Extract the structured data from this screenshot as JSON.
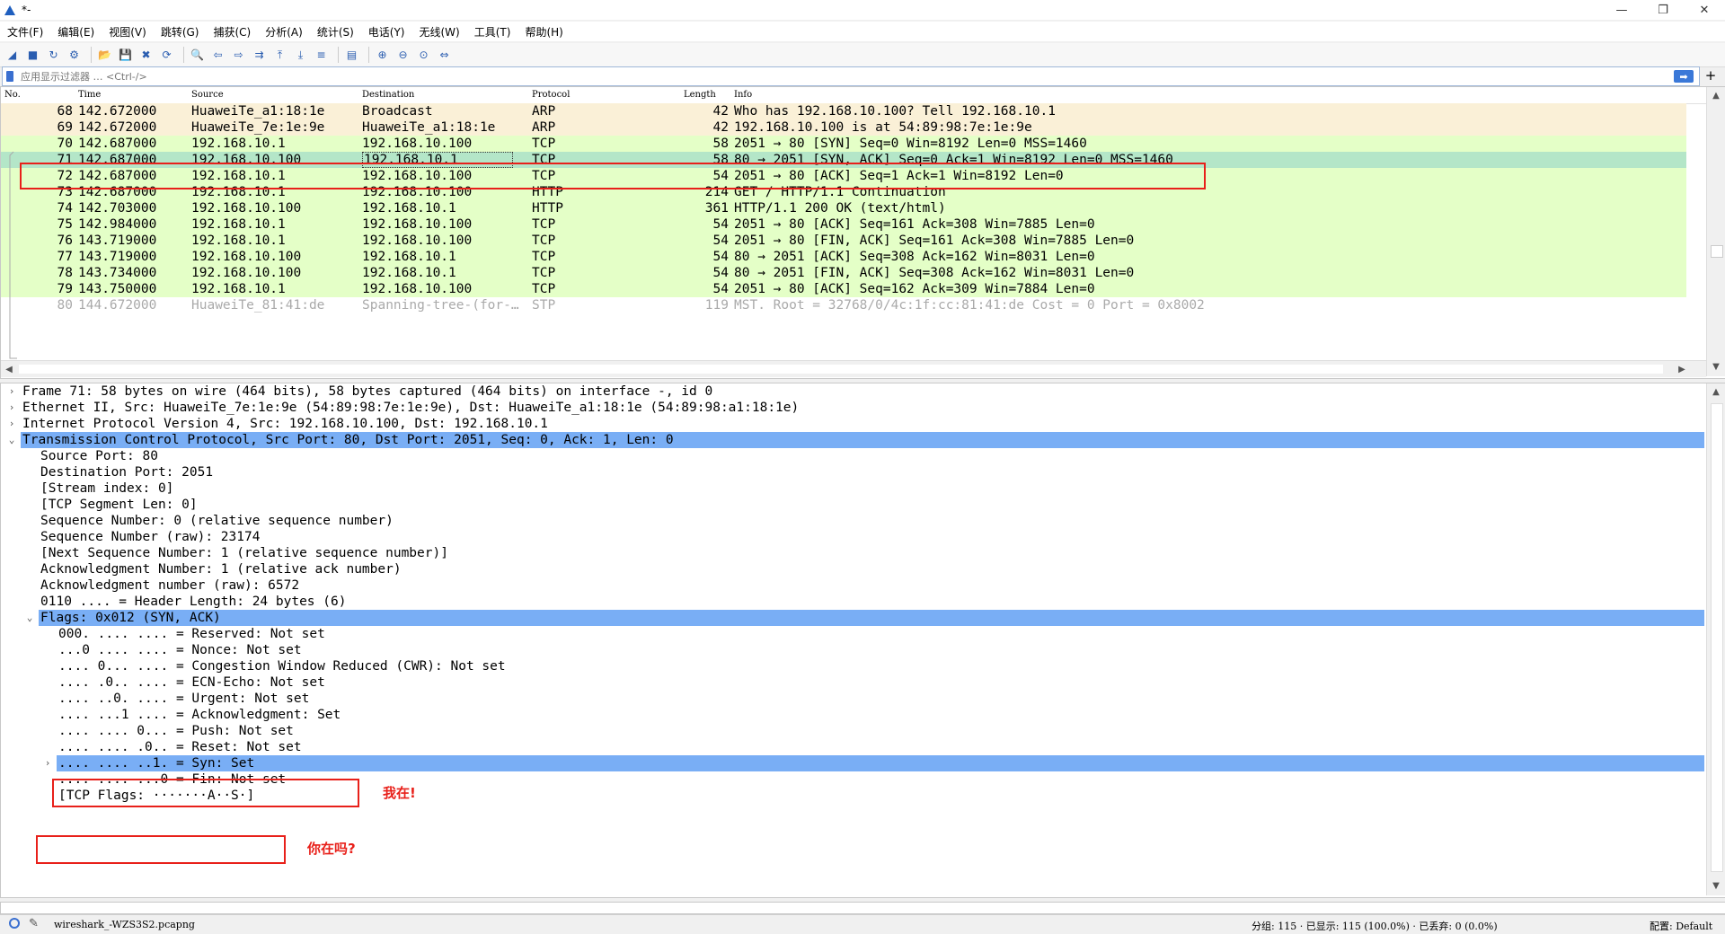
{
  "window": {
    "title": "*-",
    "minimize": "—",
    "maximize": "❐",
    "close": "✕"
  },
  "menu": [
    "文件(F)",
    "编辑(E)",
    "视图(V)",
    "跳转(G)",
    "捕获(C)",
    "分析(A)",
    "统计(S)",
    "电话(Y)",
    "无线(W)",
    "工具(T)",
    "帮助(H)"
  ],
  "toolbar": {
    "icons": [
      "shark-fin-icon",
      "stop-icon",
      "restart-icon",
      "options-icon",
      "open-file-icon",
      "save-file-icon",
      "close-file-icon",
      "reload-icon",
      "find-icon",
      "go-back-icon",
      "go-forward-icon",
      "go-to-packet-icon",
      "first-packet-icon",
      "last-packet-icon",
      "auto-scroll-icon",
      "colorize-icon",
      "zoom-in-icon",
      "zoom-out-icon",
      "zoom-normal-icon",
      "resize-columns-icon"
    ]
  },
  "filter": {
    "placeholder": "应用显示过滤器 … <Ctrl-/>",
    "apply": "➡",
    "add": "+"
  },
  "columns": {
    "no": "No.",
    "time": "Time",
    "source": "Source",
    "destination": "Destination",
    "protocol": "Protocol",
    "length": "Length",
    "info": "Info"
  },
  "packets": [
    {
      "no": "68",
      "time": "142.672000",
      "src": "HuaweiTe_a1:18:1e",
      "dst": "Broadcast",
      "proto": "ARP",
      "len": "42",
      "info": "Who has 192.168.10.100? Tell 192.168.10.1",
      "color": "#faf0d7"
    },
    {
      "no": "69",
      "time": "142.672000",
      "src": "HuaweiTe_7e:1e:9e",
      "dst": "HuaweiTe_a1:18:1e",
      "proto": "ARP",
      "len": "42",
      "info": "192.168.10.100 is at 54:89:98:7e:1e:9e",
      "color": "#faf0d7"
    },
    {
      "no": "70",
      "time": "142.687000",
      "src": "192.168.10.1",
      "dst": "192.168.10.100",
      "proto": "TCP",
      "len": "58",
      "info": "2051 → 80 [SYN] Seq=0 Win=8192 Len=0 MSS=1460",
      "color": "#e4ffc7"
    },
    {
      "no": "71",
      "time": "142.687000",
      "src": "192.168.10.100",
      "dst": "192.168.10.1",
      "proto": "TCP",
      "len": "58",
      "info": "80 → 2051 [SYN, ACK] Seq=0 Ack=1 Win=8192 Len=0 MSS=1460",
      "color": "#b4e6c8"
    },
    {
      "no": "72",
      "time": "142.687000",
      "src": "192.168.10.1",
      "dst": "192.168.10.100",
      "proto": "TCP",
      "len": "54",
      "info": "2051 → 80 [ACK] Seq=1 Ack=1 Win=8192 Len=0",
      "color": "#e4ffc7"
    },
    {
      "no": "73",
      "time": "142.687000",
      "src": "192.168.10.1",
      "dst": "192.168.10.100",
      "proto": "HTTP",
      "len": "214",
      "info": "GET / HTTP/1.1 Continuation",
      "color": "#e4ffc7"
    },
    {
      "no": "74",
      "time": "142.703000",
      "src": "192.168.10.100",
      "dst": "192.168.10.1",
      "proto": "HTTP",
      "len": "361",
      "info": "HTTP/1.1 200 OK  (text/html)",
      "color": "#e4ffc7"
    },
    {
      "no": "75",
      "time": "142.984000",
      "src": "192.168.10.1",
      "dst": "192.168.10.100",
      "proto": "TCP",
      "len": "54",
      "info": "2051 → 80 [ACK] Seq=161 Ack=308 Win=7885 Len=0",
      "color": "#e4ffc7"
    },
    {
      "no": "76",
      "time": "143.719000",
      "src": "192.168.10.1",
      "dst": "192.168.10.100",
      "proto": "TCP",
      "len": "54",
      "info": "2051 → 80 [FIN, ACK] Seq=161 Ack=308 Win=7885 Len=0",
      "color": "#e4ffc7"
    },
    {
      "no": "77",
      "time": "143.719000",
      "src": "192.168.10.100",
      "dst": "192.168.10.1",
      "proto": "TCP",
      "len": "54",
      "info": "80 → 2051 [ACK] Seq=308 Ack=162 Win=8031 Len=0",
      "color": "#e4ffc7"
    },
    {
      "no": "78",
      "time": "143.734000",
      "src": "192.168.10.100",
      "dst": "192.168.10.1",
      "proto": "TCP",
      "len": "54",
      "info": "80 → 2051 [FIN, ACK] Seq=308 Ack=162 Win=8031 Len=0",
      "color": "#e4ffc7"
    },
    {
      "no": "79",
      "time": "143.750000",
      "src": "192.168.10.1",
      "dst": "192.168.10.100",
      "proto": "TCP",
      "len": "54",
      "info": "2051 → 80 [ACK] Seq=162 Ack=309 Win=7884 Len=0",
      "color": "#e4ffc7"
    },
    {
      "no": "80",
      "time": "144.672000",
      "src": "HuaweiTe_81:41:de",
      "dst": "Spanning-tree-(for-…",
      "proto": "STP",
      "len": "119",
      "info": "MST. Root = 32768/0/4c:1f:cc:81:41:de  Cost = 0  Port = 0x8002",
      "color": "#ffffff",
      "faded": true
    }
  ],
  "details": [
    {
      "text": "Frame 71: 58 bytes on wire (464 bits), 58 bytes captured (464 bits) on interface -, id 0",
      "level": 0,
      "exp": "›"
    },
    {
      "text": "Ethernet II, Src: HuaweiTe_7e:1e:9e (54:89:98:7e:1e:9e), Dst: HuaweiTe_a1:18:1e (54:89:98:a1:18:1e)",
      "level": 0,
      "exp": "›"
    },
    {
      "text": "Internet Protocol Version 4, Src: 192.168.10.100, Dst: 192.168.10.1",
      "level": 0,
      "exp": "›"
    },
    {
      "text": "Transmission Control Protocol, Src Port: 80, Dst Port: 2051, Seq: 0, Ack: 1, Len: 0",
      "level": 0,
      "exp": "⌄",
      "hl": true
    },
    {
      "text": "Source Port: 80",
      "level": 1
    },
    {
      "text": "Destination Port: 2051",
      "level": 1
    },
    {
      "text": "[Stream index: 0]",
      "level": 1
    },
    {
      "text": "[TCP Segment Len: 0]",
      "level": 1
    },
    {
      "text": "Sequence Number: 0    (relative sequence number)",
      "level": 1
    },
    {
      "text": "Sequence Number (raw): 23174",
      "level": 1
    },
    {
      "text": "[Next Sequence Number: 1    (relative sequence number)]",
      "level": 1
    },
    {
      "text": "Acknowledgment Number: 1    (relative ack number)",
      "level": 1
    },
    {
      "text": "Acknowledgment number (raw): 6572",
      "level": 1
    },
    {
      "text": "0110 .... = Header Length: 24 bytes (6)",
      "level": 1
    },
    {
      "text": "Flags: 0x012 (SYN, ACK)",
      "level": 1,
      "exp": "⌄",
      "hl": true
    },
    {
      "text": "000. .... .... = Reserved: Not set",
      "level": 2
    },
    {
      "text": "...0 .... .... = Nonce: Not set",
      "level": 2
    },
    {
      "text": ".... 0... .... = Congestion Window Reduced (CWR): Not set",
      "level": 2
    },
    {
      "text": ".... .0.. .... = ECN-Echo: Not set",
      "level": 2
    },
    {
      "text": ".... ..0. .... = Urgent: Not set",
      "level": 2
    },
    {
      "text": ".... ...1 .... = Acknowledgment: Set",
      "level": 2
    },
    {
      "text": ".... .... 0... = Push: Not set",
      "level": 2
    },
    {
      "text": ".... .... .0.. = Reset: Not set",
      "level": 2
    },
    {
      "text": ".... .... ..1. = Syn: Set",
      "level": 2,
      "exp": "›",
      "hl": true
    },
    {
      "text": ".... .... ...0 = Fin: Not set",
      "level": 2
    },
    {
      "text": "[TCP Flags: ·······A··S·]",
      "level": 2
    }
  ],
  "annotations": {
    "ack": "我在!",
    "syn": "你在吗?"
  },
  "status": {
    "file": "wireshark_-WZS3S2.pcapng",
    "stats": "分组: 115 · 已显示: 115 (100.0%) · 已丢弃: 0 (0.0%)",
    "profile": "配置: Default"
  }
}
